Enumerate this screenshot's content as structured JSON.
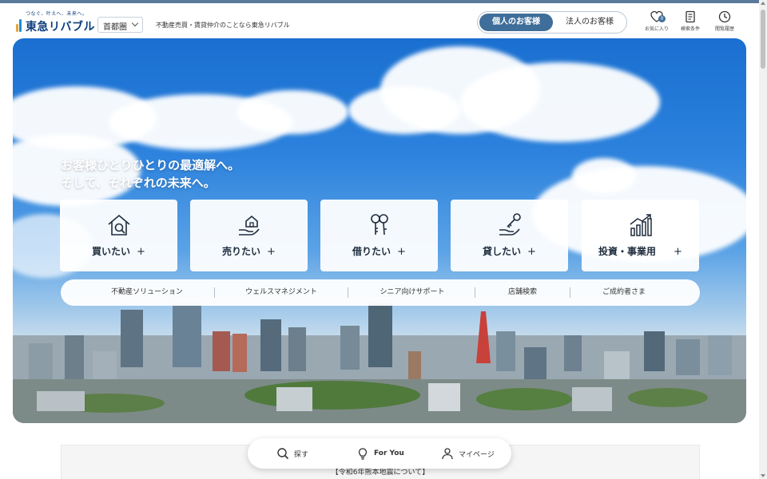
{
  "header": {
    "tagline": "つなぐ、叶えへ、未来へ。",
    "logo_text": "東急リバブル",
    "region": "首都圏",
    "description": "不動産売買・賃貸仲介のことなら東急リバブル",
    "audience": {
      "active": "個人のお客様",
      "inactive": "法人のお客様"
    },
    "icons": [
      {
        "name": "heart-icon",
        "label": "お気に入り",
        "count": "0"
      },
      {
        "name": "search-conditions-icon",
        "label": "検索条件"
      },
      {
        "name": "clock-icon",
        "label": "閲覧履歴"
      }
    ]
  },
  "hero": {
    "tagline_line1": "お客様ひとりひとりの最適解へ。",
    "tagline_line2": "そして、それぞれの未来へ。",
    "services": [
      {
        "label": "買いたい",
        "icon": "house-search-icon"
      },
      {
        "label": "売りたい",
        "icon": "hand-house-icon"
      },
      {
        "label": "借りたい",
        "icon": "keys-icon"
      },
      {
        "label": "貸したい",
        "icon": "hand-key-icon"
      },
      {
        "label": "投資・事業用",
        "icon": "bar-chart-icon"
      }
    ],
    "plus_symbol": "+",
    "subnav": [
      "不動産ソリューション",
      "ウェルスマネジメント",
      "シニア向けサポート",
      "店舗検索",
      "ご成約者さま"
    ]
  },
  "notice": {
    "text": "【令和6年熊本地震について】"
  },
  "bottom_nav": {
    "items": [
      {
        "label": "探す",
        "icon": "search-icon"
      },
      {
        "label": "For You",
        "icon": "lightbulb-icon"
      },
      {
        "label": "マイページ",
        "icon": "user-icon"
      }
    ]
  },
  "colors": {
    "brand": "#0d3d7a",
    "accent": "#3e6e99",
    "sky": "#2c82dd"
  }
}
